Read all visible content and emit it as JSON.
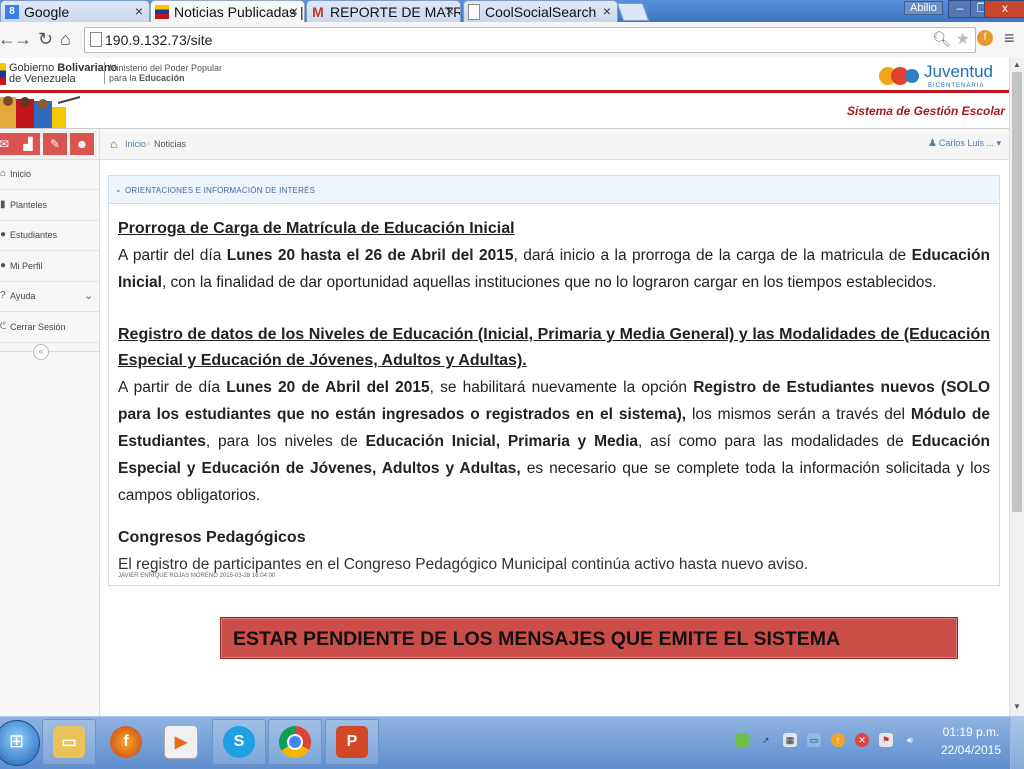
{
  "browser": {
    "tabs": [
      {
        "title": "Google",
        "active": false
      },
      {
        "title": "Noticias Publicadas |",
        "active": true
      },
      {
        "title": "REPORTE DE MATRÍC",
        "active": false
      },
      {
        "title": "CoolSocialSearch",
        "active": false
      }
    ],
    "window_user": "Abilio",
    "url": "190.9.132.73/site"
  },
  "header": {
    "gob_line1_a": "Gobierno ",
    "gob_line1_b": "Bolivariano",
    "gob_line2": "de Venezuela",
    "ministry_line1": "Ministerio del Poder Popular",
    "ministry_line2_a": "para la ",
    "ministry_line2_b": "Educación",
    "logo_text": "Juventud",
    "logo_subtext": "BICENTENARIA",
    "system_title": "Sistema de Gestión Escolar"
  },
  "sidebar": {
    "items": [
      {
        "label": "Inicio",
        "icon": "home-icon"
      },
      {
        "label": "Planteles",
        "icon": "building-icon"
      },
      {
        "label": "Estudiantes",
        "icon": "users-icon"
      },
      {
        "label": "Mi Perfil",
        "icon": "user-icon"
      },
      {
        "label": "Ayuda",
        "icon": "help-icon"
      },
      {
        "label": "Cerrar Sesión",
        "icon": "power-icon"
      }
    ]
  },
  "breadcrumb": {
    "home": "Inicio",
    "current": "Noticias"
  },
  "user_menu": "Carlos Luis ...",
  "panel": {
    "title": "ORIENTACIONES E INFORMACIÓN DE INTERÉS",
    "news1_heading": "Prorroga de Carga de Matrícula de Educación Inicial",
    "news1": {
      "a": "A partir del día ",
      "b": "Lunes 20 hasta el 26 de Abril del 2015",
      "c": ", dará inicio a la prorroga de la carga de la matricula de ",
      "d": "Educación Inicial",
      "e": ", con la finalidad de dar oportunidad aquellas instituciones que no lo lograron cargar en los tiempos establecidos."
    },
    "news2_heading": "Registro de datos de los Niveles de Educación (Inicial, Primaria y Media General) y las Modalidades de (Educación Especial y Educación de Jóvenes, Adultos y Adultas).",
    "news2": {
      "a": "A partir de día ",
      "b": "Lunes 20 de Abril del 2015",
      "c": ", se habilitará nuevamente la opción ",
      "d": "Registro de Estudiantes nuevos (SOLO para los estudiantes que no están ingresados o registrados en el sistema),",
      "e": " los mismos serán a través del ",
      "f": "Módulo de Estudiantes",
      "g": ", para los niveles de ",
      "h": "Educación Inicial, Primaria y Media",
      "i": ", así como para las modalidades de ",
      "j": "Educación Especial y Educación de Jóvenes, Adultos y Adultas,",
      "k": " es necesario que se complete toda la información solicitada y los campos obligatorios."
    },
    "news3_heading": "Congresos Pedagógicos",
    "news3": "El registro de participantes en el Congreso Pedagógico Municipal continúa activo hasta nuevo aviso.",
    "author": "JAVIER ENRIQUE ROJAS MORENO 2015-03-28 16:04:00"
  },
  "alert": "ESTAR PENDIENTE DE LOS MENSAJES QUE EMITE EL SISTEMA",
  "taskbar": {
    "apps": [
      "file-explorer-icon",
      "firefox-icon",
      "media-player-icon",
      "skype-icon",
      "chrome-icon",
      "powerpoint-icon"
    ],
    "time": "01:19 p.m.",
    "date": "22/04/2015"
  },
  "colors": {
    "accent_red": "#c0151b",
    "alert_bg": "#ca4d48",
    "shortcut_red": "#d9534f",
    "link_blue": "#4a7bb7"
  }
}
